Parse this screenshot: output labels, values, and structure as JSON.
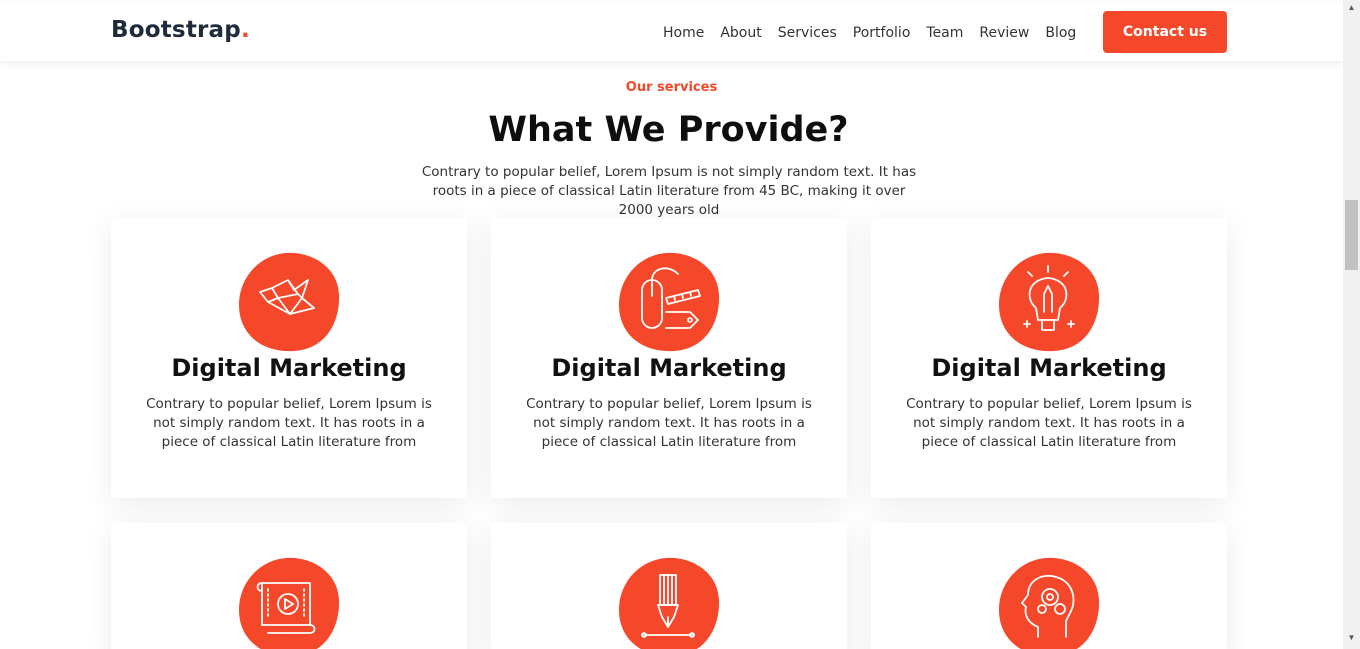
{
  "navbar": {
    "brand": "Bootstrap",
    "brand_dot": ".",
    "links": [
      "Home",
      "About",
      "Services",
      "Portfolio",
      "Team",
      "Review",
      "Blog"
    ],
    "cta_label": "Contact us"
  },
  "section": {
    "eyebrow": "Our services",
    "title": "What We Provide?",
    "description": "Contrary to popular belief, Lorem Ipsum is not simply random text. It has roots in a piece of classical Latin literature from 45 BC, making it over 2000 years old"
  },
  "services": [
    {
      "title": "Digital Marketing",
      "text": "Contrary to popular belief, Lorem Ipsum is not simply random text. It has roots in a piece of classical Latin literature from",
      "icon": "origami-bird-icon"
    },
    {
      "title": "Digital Marketing",
      "text": "Contrary to popular belief, Lorem Ipsum is not simply random text. It has roots in a piece of classical Latin literature from",
      "icon": "mouse-pencil-ruler-icon"
    },
    {
      "title": "Digital Marketing",
      "text": "Contrary to popular belief, Lorem Ipsum is not simply random text. It has roots in a piece of classical Latin literature from",
      "icon": "lightbulb-pencil-icon"
    },
    {
      "title": "",
      "text": "",
      "icon": "video-scroll-icon"
    },
    {
      "title": "",
      "text": "",
      "icon": "pen-nib-icon"
    },
    {
      "title": "",
      "text": "",
      "icon": "head-gears-icon"
    }
  ],
  "colors": {
    "accent": "#f5472a",
    "brand_text": "#1d2b3a"
  }
}
